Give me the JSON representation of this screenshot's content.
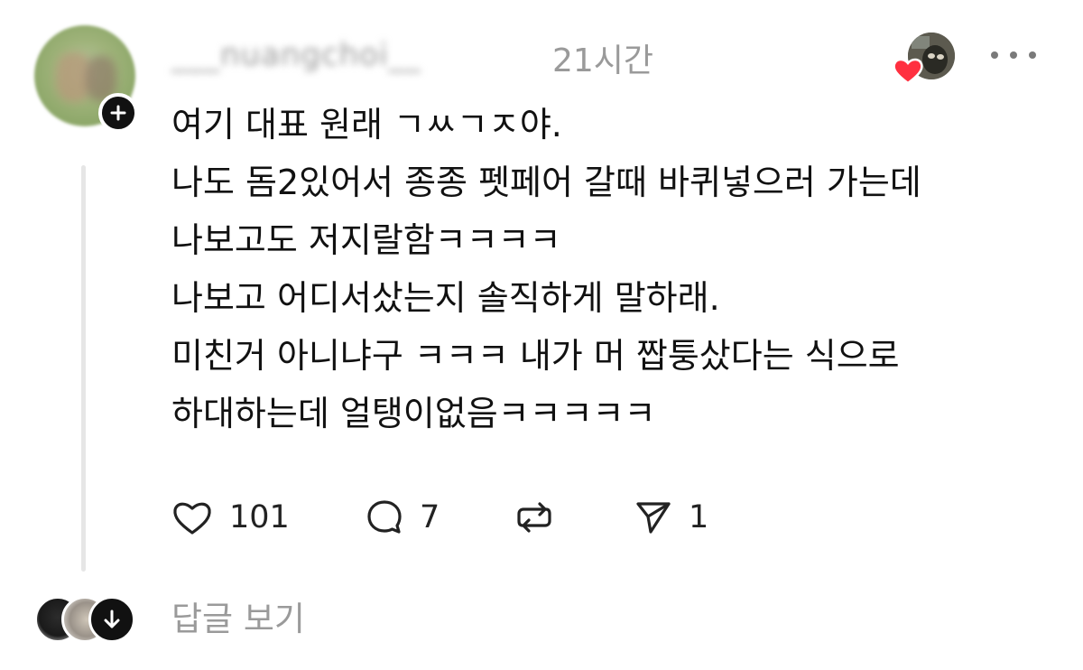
{
  "post": {
    "username": "___nuangchoi__",
    "timestamp": "21시간",
    "body_lines": [
      "여기 대표 원래 ㄱㅆㄱㅈ야.",
      "나도 돔2있어서 종종 펫페어 갈때 바퀴넣으러 가는데",
      "나보고도 저지랄함ㅋㅋㅋㅋ",
      "나보고 어디서샀는지 솔직하게 말하래.",
      "미친거 아니냐구 ㅋㅋㅋ 내가 머 짭퉁샀다는 식으로",
      "하대하는데 얼탱이없음ㅋㅋㅋㅋㅋ"
    ]
  },
  "actions": {
    "like_count": "101",
    "comment_count": "7",
    "share_count": "1"
  },
  "replies": {
    "view_label": "답글 보기"
  },
  "colors": {
    "muted_text": "#9a9a9a",
    "heart_red": "#ff3040",
    "thread_line": "#e6e6e6"
  }
}
